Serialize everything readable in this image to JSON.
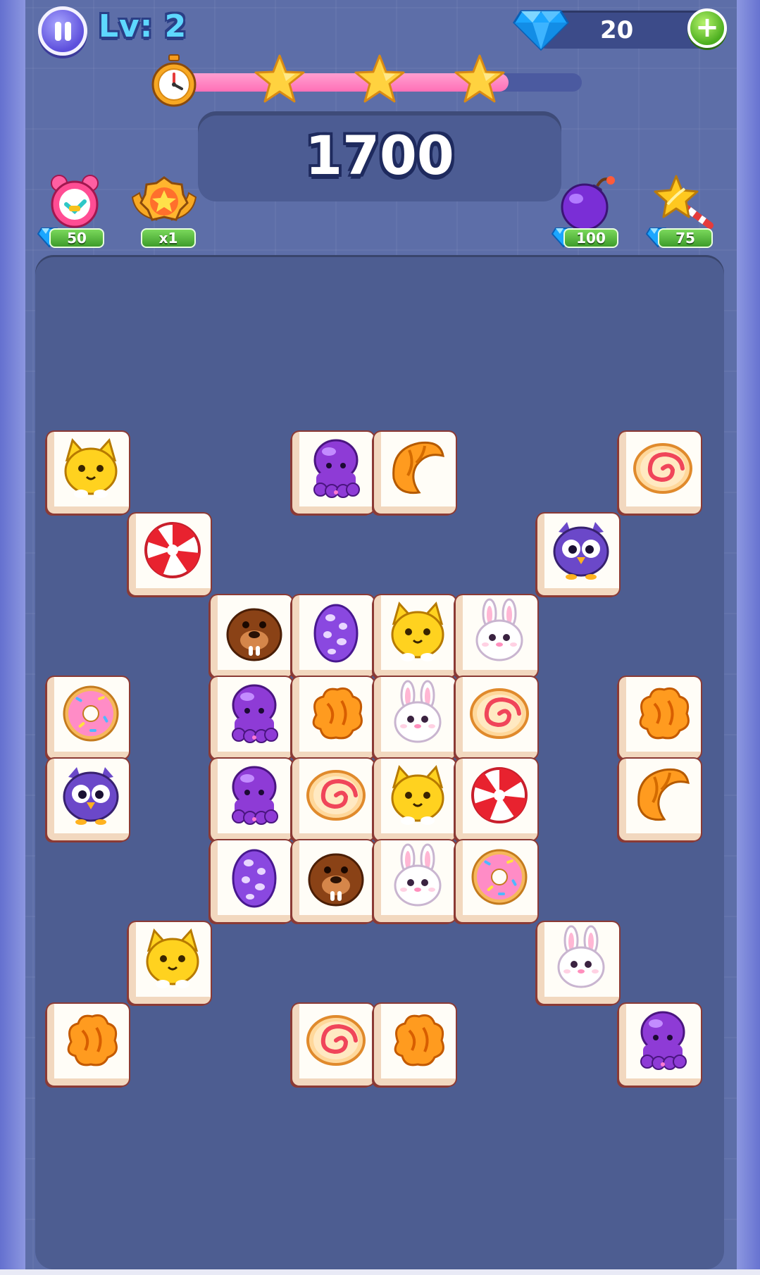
{
  "header": {
    "level_label": "Lv: 2",
    "gem_count": "20",
    "add_gems_symbol": "+"
  },
  "progress": {
    "fill_fraction": 0.82,
    "stars_earned": 3,
    "icons": [
      "alarm-clock-icon",
      "star-icon",
      "star-icon",
      "star-icon"
    ]
  },
  "score": {
    "value": "1700"
  },
  "powerups": [
    {
      "name": "extra-time-clock",
      "icon": "alarm-clock-icon",
      "cost": "50",
      "cost_icon": "gem-icon"
    },
    {
      "name": "score-multiplier",
      "icon": "star-medal-icon",
      "cost": "x1"
    },
    {
      "name": "bomb",
      "icon": "bomb-icon",
      "cost": "100",
      "cost_icon": "gem-icon"
    },
    {
      "name": "magic-wand",
      "icon": "star-wand-icon",
      "cost": "75",
      "cost_icon": "gem-icon"
    }
  ],
  "board": {
    "tile_types": [
      "cat",
      "octopus",
      "croissant",
      "swirl-roll",
      "peppermint",
      "owl",
      "walrus",
      "egg",
      "bunny",
      "donut",
      "cookie"
    ],
    "tiles": [
      {
        "row": 0,
        "col": 0,
        "type": "cat"
      },
      {
        "row": 0,
        "col": 3,
        "type": "octopus"
      },
      {
        "row": 0,
        "col": 4,
        "type": "croissant"
      },
      {
        "row": 0,
        "col": 7,
        "type": "swirl-roll"
      },
      {
        "row": 1,
        "col": 1,
        "type": "peppermint"
      },
      {
        "row": 1,
        "col": 6,
        "type": "owl"
      },
      {
        "row": 2,
        "col": 2,
        "type": "walrus"
      },
      {
        "row": 2,
        "col": 3,
        "type": "egg"
      },
      {
        "row": 2,
        "col": 4,
        "type": "cat"
      },
      {
        "row": 2,
        "col": 5,
        "type": "bunny"
      },
      {
        "row": 3,
        "col": 0,
        "type": "donut"
      },
      {
        "row": 3,
        "col": 2,
        "type": "octopus"
      },
      {
        "row": 3,
        "col": 3,
        "type": "cookie"
      },
      {
        "row": 3,
        "col": 4,
        "type": "bunny"
      },
      {
        "row": 3,
        "col": 5,
        "type": "swirl-roll"
      },
      {
        "row": 3,
        "col": 7,
        "type": "cookie"
      },
      {
        "row": 4,
        "col": 0,
        "type": "owl"
      },
      {
        "row": 4,
        "col": 2,
        "type": "octopus"
      },
      {
        "row": 4,
        "col": 3,
        "type": "swirl-roll"
      },
      {
        "row": 4,
        "col": 4,
        "type": "cat"
      },
      {
        "row": 4,
        "col": 5,
        "type": "peppermint"
      },
      {
        "row": 4,
        "col": 7,
        "type": "croissant"
      },
      {
        "row": 5,
        "col": 2,
        "type": "egg"
      },
      {
        "row": 5,
        "col": 3,
        "type": "walrus"
      },
      {
        "row": 5,
        "col": 4,
        "type": "bunny"
      },
      {
        "row": 5,
        "col": 5,
        "type": "donut"
      },
      {
        "row": 6,
        "col": 1,
        "type": "cat"
      },
      {
        "row": 6,
        "col": 6,
        "type": "bunny"
      },
      {
        "row": 7,
        "col": 0,
        "type": "cookie"
      },
      {
        "row": 7,
        "col": 3,
        "type": "swirl-roll"
      },
      {
        "row": 7,
        "col": 4,
        "type": "cookie"
      },
      {
        "row": 7,
        "col": 7,
        "type": "octopus"
      }
    ]
  },
  "colors": {
    "frame": "#7b86d6",
    "game_background": "#5d6ea8",
    "board_panel": "#4d5d91",
    "progress_fill": "#ff70b7",
    "level_text": "#5ed8ff",
    "badge_green": "#3d9c2a",
    "tile_face": "#fffdf7",
    "tile_outline": "#8b3a35"
  }
}
